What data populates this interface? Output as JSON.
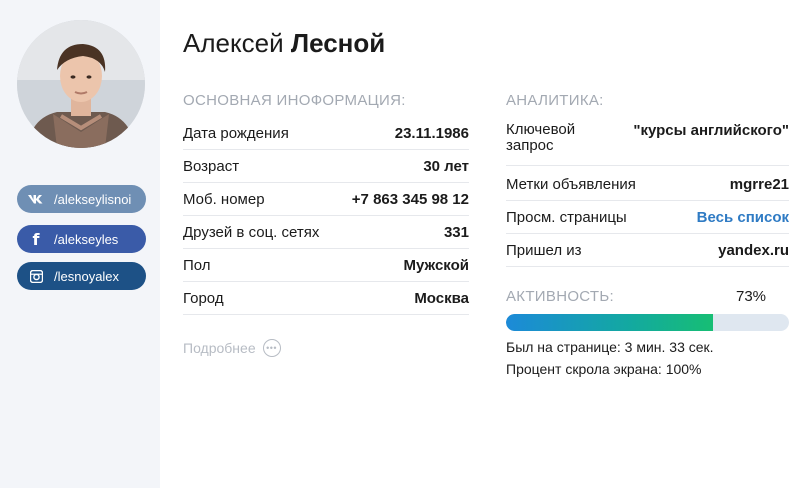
{
  "profile": {
    "first_name": "Алексей",
    "last_name": "Лесной"
  },
  "social": [
    {
      "network": "vk",
      "icon": "vk-icon",
      "handle": "/alekseylisnoi",
      "color": "#6f8fb4"
    },
    {
      "network": "facebook",
      "icon": "facebook-icon",
      "handle": "/alekseyles",
      "color": "#3a5ba8"
    },
    {
      "network": "instagram",
      "icon": "instagram-icon",
      "handle": "/lesnoyalex",
      "color": "#1d5186"
    }
  ],
  "basic_info": {
    "title": "ОСНОВНАЯ ИНОФОРМАЦИЯ:",
    "rows": [
      {
        "label": "Дата рождения",
        "value": "23.11.1986"
      },
      {
        "label": "Возраст",
        "value": "30 лет"
      },
      {
        "label": "Моб. номер",
        "value": "+7 863 345 98 12"
      },
      {
        "label": "Друзей в соц. сетях",
        "value": "331"
      },
      {
        "label": "Пол",
        "value": "Мужской"
      },
      {
        "label": "Город",
        "value": "Москва"
      }
    ],
    "more_label": "Подробнее"
  },
  "analytics": {
    "title": "АНАЛИТИКА:",
    "rows": [
      {
        "label": "Ключевой запрос",
        "value": "\"курсы английского\""
      },
      {
        "label": "Метки объявления",
        "value": "mgrre21"
      },
      {
        "label": "Просм. страницы",
        "value": "Весь список"
      },
      {
        "label": "Пришел из",
        "value": "yandex.ru"
      }
    ]
  },
  "activity": {
    "title": "АКТИВНОСТЬ:",
    "percent_label": "73%",
    "percent": 73,
    "time_on_page": "Был на странице: 3 мин. 33 сек.",
    "scroll": "Процент скрола экрана: 100%"
  },
  "colors": {
    "link": "#2f7bc4",
    "progress_start": "#1c8ad8",
    "progress_end": "#17be74",
    "sidebar_bg": "#f3f5f9"
  }
}
